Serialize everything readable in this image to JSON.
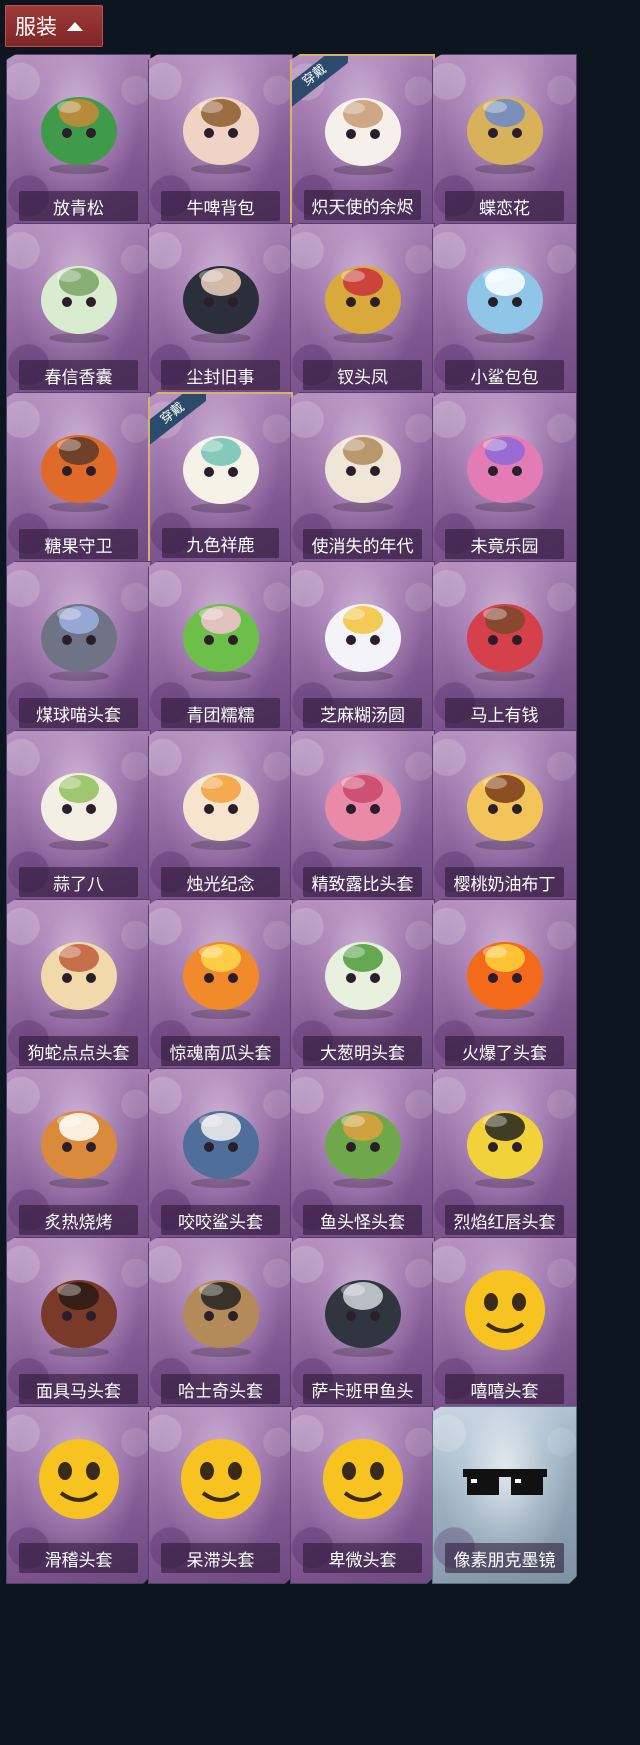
{
  "section": {
    "label": "服装"
  },
  "items": [
    {
      "name": "放青松",
      "icon": "bonsai-pine-icon"
    },
    {
      "name": "牛啤背包",
      "icon": "cow-beer-mug-icon"
    },
    {
      "name": "炽天使的余烬",
      "icon": "angel-doll-icon",
      "badge": "穿戴"
    },
    {
      "name": "蝶恋花",
      "icon": "floral-ornament-icon"
    },
    {
      "name": "春信香囊",
      "icon": "sachet-pouch-icon"
    },
    {
      "name": "尘封旧事",
      "icon": "chibi-gentleman-icon"
    },
    {
      "name": "钗头凤",
      "icon": "phoenix-crown-doll-icon"
    },
    {
      "name": "小鲨包包",
      "icon": "shark-bag-icon"
    },
    {
      "name": "糖果守卫",
      "icon": "pumpkin-scarecrow-icon"
    },
    {
      "name": "九色祥鹿",
      "icon": "deer-charm-icon",
      "badge": "穿戴"
    },
    {
      "name": "使消失的年代",
      "icon": "veiled-doll-icon"
    },
    {
      "name": "未竟乐园",
      "icon": "pink-hair-doll-icon"
    },
    {
      "name": "煤球喵头套",
      "icon": "gray-cat-head-icon"
    },
    {
      "name": "青团糯糯",
      "icon": "green-mochi-head-icon"
    },
    {
      "name": "芝麻糊汤圆",
      "icon": "rice-ball-head-icon"
    },
    {
      "name": "马上有钱",
      "icon": "red-horse-head-icon"
    },
    {
      "name": "蒜了八",
      "icon": "garlic-head-icon"
    },
    {
      "name": "烛光纪念",
      "icon": "candle-head-icon"
    },
    {
      "name": "精致露比头套",
      "icon": "pink-beaver-head-icon"
    },
    {
      "name": "樱桃奶油布丁",
      "icon": "pudding-head-icon"
    },
    {
      "name": "狗蛇点点头套",
      "icon": "snake-dog-head-icon"
    },
    {
      "name": "惊魂南瓜头套",
      "icon": "jack-o-lantern-head-icon"
    },
    {
      "name": "大葱明头套",
      "icon": "scallion-head-icon"
    },
    {
      "name": "火爆了头套",
      "icon": "fire-head-icon"
    },
    {
      "name": "炙热烧烤",
      "icon": "grilled-meat-head-icon"
    },
    {
      "name": "咬咬鲨头套",
      "icon": "shark-head-icon"
    },
    {
      "name": "鱼头怪头套",
      "icon": "fish-head-icon"
    },
    {
      "name": "烈焰红唇头套",
      "icon": "yellow-creature-head-icon"
    },
    {
      "name": "面具马头套",
      "icon": "horse-mask-icon"
    },
    {
      "name": "哈士奇头套",
      "icon": "dog-sunglasses-head-icon"
    },
    {
      "name": "萨卡班甲鱼头",
      "icon": "armored-fish-head-icon"
    },
    {
      "name": "嘻嘻头套",
      "icon": "grin-emoji-head-icon"
    },
    {
      "name": "滑稽头套",
      "icon": "smirk-emoji-head-icon"
    },
    {
      "name": "呆滞头套",
      "icon": "dazed-emoji-head-icon"
    },
    {
      "name": "卑微头套",
      "icon": "humble-emoji-head-icon"
    },
    {
      "name": "像素朋克墨镜",
      "icon": "pixel-sunglasses-icon"
    }
  ]
}
